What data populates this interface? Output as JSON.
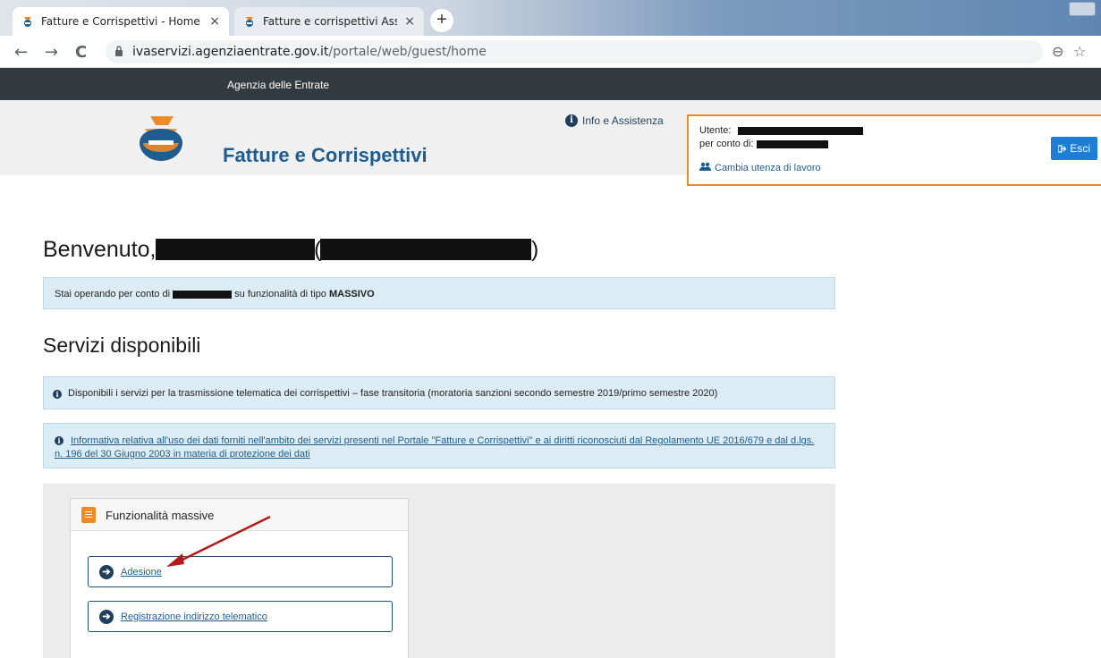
{
  "browser": {
    "tabs": [
      {
        "title": "Fatture e Corrispettivi - Home",
        "close": "×"
      },
      {
        "title": "Fatture e corrispettivi Assistenza",
        "close": "×"
      }
    ],
    "new_tab": "+",
    "nav": {
      "back": "←",
      "forward": "→",
      "reload": "C"
    },
    "url_host": "ivaservizi.agenziaentrate.gov.it",
    "url_path": "/portale/web/guest/home",
    "zoom_icon": "⊖",
    "star_icon": "☆"
  },
  "topbar": {
    "label": "Agenzia delle Entrate"
  },
  "header": {
    "site_title": "Fatture e Corrispettivi",
    "info_link": "Info e Assistenza"
  },
  "user_panel": {
    "utente_label": "Utente:",
    "per_conto_label": "per conto di:",
    "per_conto_prefix": "",
    "cambia_label": "Cambia utenza di lavoro",
    "esci_label": "Esci"
  },
  "welcome": {
    "prefix": "Benvenuto,",
    "paren_open": "(",
    "paren_close": ")"
  },
  "operating_alert": {
    "before": "Stai operando per conto di",
    "after": "su funzionalità di tipo",
    "mode": "MASSIVO"
  },
  "services_heading": "Servizi disponibili",
  "notice_1": "Disponibili i servizi per la trasmissione telematica dei corrispettivi – fase transitoria (moratoria sanzioni secondo semestre 2019/primo semestre 2020)",
  "notice_2": "Informativa relativa all'uso dei dati forniti nell'ambito dei servizi presenti nel Portale \"Fatture e Corrispettivi\" e ai diritti riconosciuti dal Regolamento UE 2016/679 e dal d.lgs. n. 196 del 30 Giugno 2003 in materia di protezione dei dati",
  "card": {
    "title": "Funzionalità massive",
    "buttons": [
      {
        "label": "Adesione"
      },
      {
        "label": "Registrazione indirizzo telematico"
      }
    ]
  },
  "colors": {
    "accent_orange": "#f08a24",
    "brand_blue": "#1f5d8f",
    "button_blue": "#1e7ed6",
    "annotation_red": "#b01a1a"
  },
  "icons": {
    "info": "info-icon",
    "users": "users-icon",
    "logout": "logout-icon",
    "arrow": "arrow-right-circle-icon",
    "document": "document-icon"
  }
}
